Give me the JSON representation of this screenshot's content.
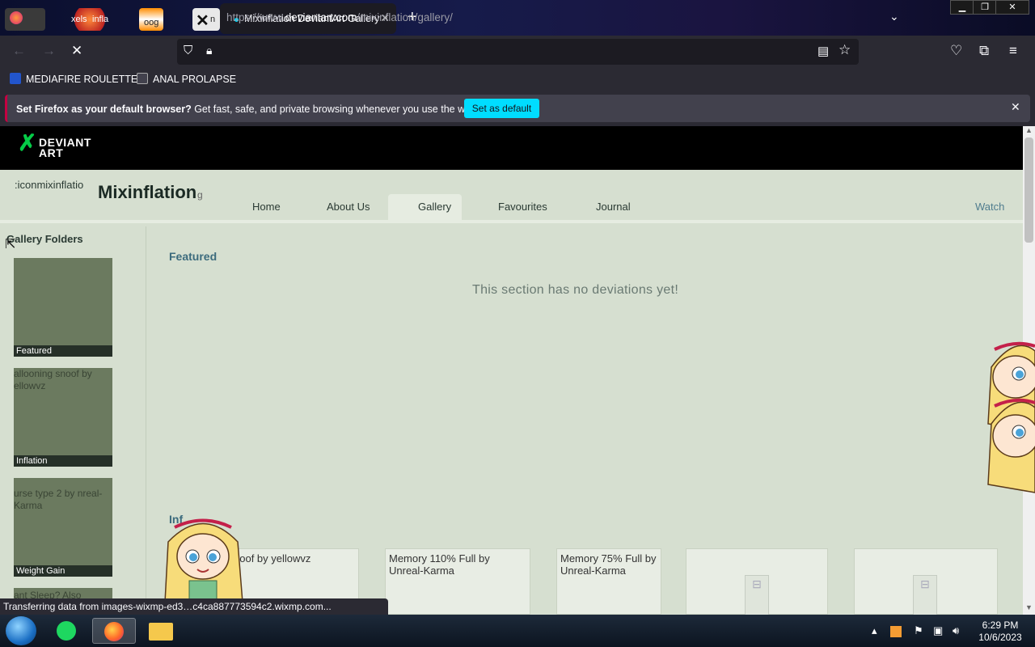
{
  "browser": {
    "tabs": [
      {
        "label": "Mixinflation DeviantArt Gallery",
        "active": true
      },
      {
        "label": "xels",
        "active": false
      },
      {
        "label": "infla",
        "active": false
      },
      {
        "label": "oog",
        "active": false
      },
      {
        "label": "n",
        "active": false
      }
    ],
    "new_tab_icon": "plus-icon",
    "url_prefix": "https://www.",
    "url_domain": "deviantart.com",
    "url_path": "/mixinflation/gallery/",
    "bookmarks": [
      {
        "label": "MEDIAFIRE ROULETTER",
        "icon": "mediafire-icon"
      },
      {
        "label": "ANAL PROLAPSE",
        "icon": "bookmark-page-icon"
      }
    ],
    "notification": {
      "bold": "Set Firefox as your default browser?",
      "text": " Get fast, safe, and private browsing whenever you use the web.",
      "button": "Set as default"
    },
    "status": "Transferring data from images-wixmp-ed3…c4ca887773594c2.wixmp.com..."
  },
  "site": {
    "logo_line1": "DEVIANT",
    "logo_line2": "ART",
    "icon_alt": ":iconmixinflatio",
    "username": "Mixinflation",
    "username_tail": "g",
    "nav": [
      "Home",
      "About Us",
      "Gallery",
      "Favourites",
      "Journal"
    ],
    "watch": "Watch",
    "sidebar_title": "Gallery Folders",
    "folders": [
      {
        "caption": "Featured",
        "alt": ""
      },
      {
        "caption": "Inflation",
        "alt": "allooning snoof by ellowvz"
      },
      {
        "caption": "Weight Gain",
        "alt": "urse type 2 by nreal-Karma"
      },
      {
        "caption": "",
        "alt": "ant Sleep? Also"
      }
    ],
    "featured_heading": "Featured",
    "empty_message": "This section has no deviations yet!",
    "inflation_heading": "Inf",
    "cards": [
      "noof by yellowvz",
      "Memory 110% Full by Unreal-Karma",
      "Memory 75% Full by Unreal-Karma",
      "",
      ""
    ]
  },
  "taskbar": {
    "time": "6:29 PM",
    "date": "10/6/2023"
  }
}
